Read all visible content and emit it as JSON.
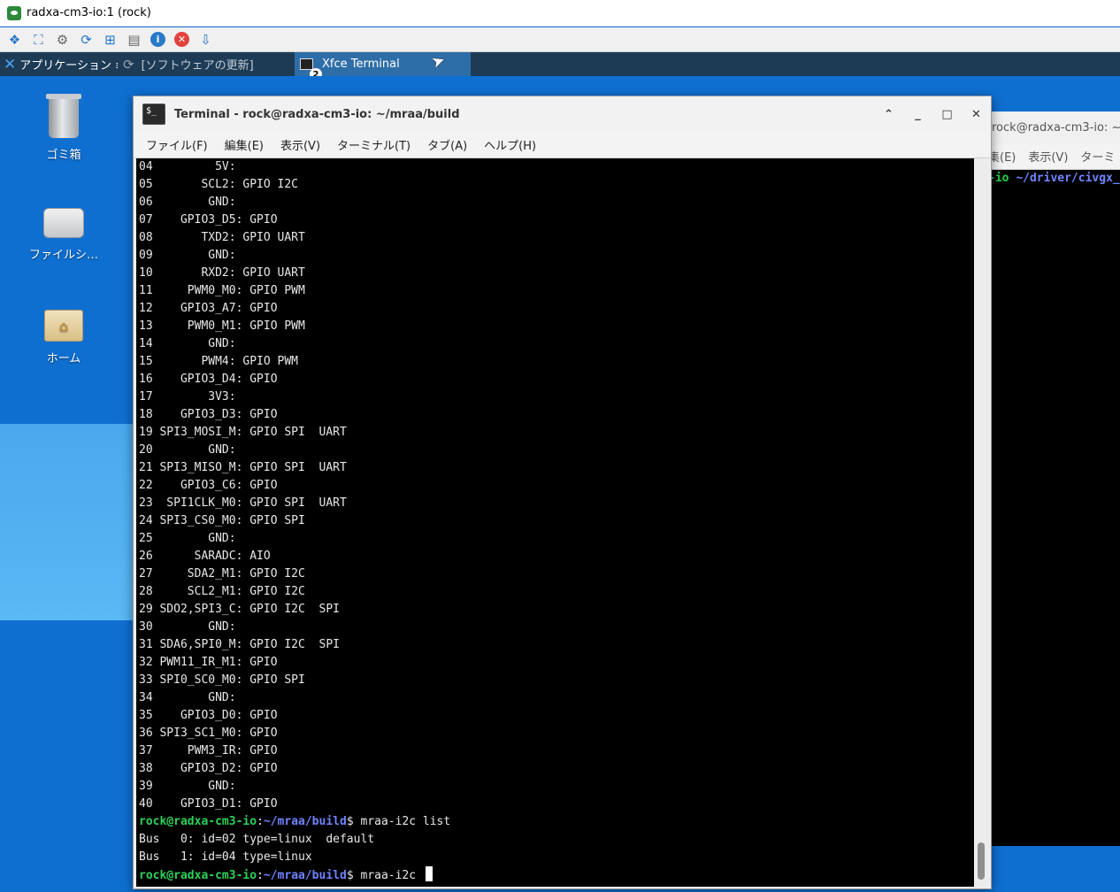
{
  "viewer": {
    "title": "radxa-cm3-io:1 (rock)",
    "toolbar": [
      {
        "name": "connection-options-icon"
      },
      {
        "name": "fullscreen-icon"
      },
      {
        "name": "settings-gear-icon"
      },
      {
        "name": "refresh-icon"
      },
      {
        "name": "windows-key-icon"
      },
      {
        "name": "clipboard-icon"
      },
      {
        "name": "info-icon"
      },
      {
        "name": "disconnect-icon"
      },
      {
        "name": "transfer-icon"
      }
    ]
  },
  "panel": {
    "apps_label": "アプリケーション ≡",
    "tasks": [
      {
        "label": "[ソフトウェアの更新]",
        "active": false
      },
      {
        "label": "Xfce Terminal",
        "active": true,
        "badge": "2"
      }
    ]
  },
  "desktop": {
    "icons": [
      {
        "label": "ゴミ箱"
      },
      {
        "label": "ファイルシ…"
      },
      {
        "label": "ホーム"
      }
    ]
  },
  "bg_terminal": {
    "title": "rock@radxa-cm3-io: ~",
    "menu": [
      "集(E)",
      "表示(V)",
      "ターミ"
    ],
    "line_host": "-io",
    "line_sep": ":",
    "line_path": "~/driver/civgx_"
  },
  "terminal": {
    "title": "Terminal - rock@radxa-cm3-io: ~/mraa/build",
    "menu": [
      "ファイル(F)",
      "編集(E)",
      "表示(V)",
      "ターミナル(T)",
      "タブ(A)",
      "ヘルプ(H)"
    ],
    "pin_lines": [
      "04         5V:",
      "05       SCL2: GPIO I2C",
      "06        GND:",
      "07    GPIO3_D5: GPIO",
      "08       TXD2: GPIO UART",
      "09        GND:",
      "10       RXD2: GPIO UART",
      "11     PWM0_M0: GPIO PWM",
      "12    GPIO3_A7: GPIO",
      "13     PWM0_M1: GPIO PWM",
      "14        GND:",
      "15       PWM4: GPIO PWM",
      "16    GPIO3_D4: GPIO",
      "17        3V3:",
      "18    GPIO3_D3: GPIO",
      "19 SPI3_MOSI_M: GPIO SPI  UART",
      "20        GND:",
      "21 SPI3_MISO_M: GPIO SPI  UART",
      "22    GPIO3_C6: GPIO",
      "23  SPI1CLK_M0: GPIO SPI  UART",
      "24 SPI3_CS0_M0: GPIO SPI",
      "25        GND:",
      "26      SARADC: AIO",
      "27     SDA2_M1: GPIO I2C",
      "28     SCL2_M1: GPIO I2C",
      "29 SDO2,SPI3_C: GPIO I2C  SPI",
      "30        GND:",
      "31 SDA6,SPI0_M: GPIO I2C  SPI",
      "32 PWM11_IR_M1: GPIO",
      "33 SPI0_SC0_M0: GPIO SPI",
      "34        GND:",
      "35    GPIO3_D0: GPIO",
      "36 SPI3_SC1_M0: GPIO",
      "37     PWM3_IR: GPIO",
      "38    GPIO3_D2: GPIO",
      "39        GND:",
      "40    GPIO3_D1: GPIO"
    ],
    "prompt_host": "rock@radxa-cm3-io",
    "prompt_sep": ":",
    "prompt_path": "~/mraa/build",
    "prompt_end": "$ ",
    "cmd1": "mraa-i2c list",
    "output": [
      "Bus   0: id=02 type=linux  default",
      "Bus   1: id=04 type=linux"
    ],
    "cmd2": "mraa-i2c "
  },
  "colors": {
    "desktop": "#0f6fd1",
    "panel": "#1d3b55",
    "prompt_host": "#2cd25a",
    "prompt_path": "#6f83ff"
  }
}
